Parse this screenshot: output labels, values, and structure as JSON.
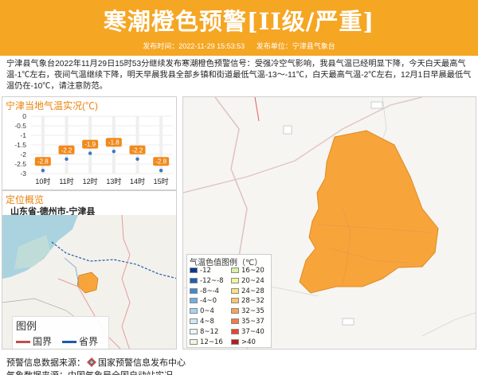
{
  "header": {
    "title": "寒潮橙色预警[II级/严重]",
    "publish_time_label": "发布时间：2022-11-29 15:53:53",
    "publisher_label": "发布单位：宁津县气象台"
  },
  "content": "宁津县气象台2022年11月29日15时53分继续发布寒潮橙色预警信号：受强冷空气影响，我县气温已经明显下降，今天白天最高气温-1℃左右，夜间气温继续下降，明天早晨我县全部乡镇和街道最低气温-13～-11℃，白天最高气温-2℃左右，12月1日早晨最低气温仍在-10℃，请注意防范。",
  "temp_panel": {
    "title": "宁津当地气温实况(℃)"
  },
  "chart_data": {
    "type": "line",
    "categories": [
      "10时",
      "11时",
      "12时",
      "13时",
      "14时",
      "15时"
    ],
    "values": [
      -2.8,
      -2.2,
      -1.9,
      -1.8,
      -2.2,
      -2.8
    ],
    "value_labels": [
      "-2.8",
      "-2.2",
      "-1.9",
      "-1.8",
      "-2.2",
      "-2.8"
    ],
    "y_ticks": [
      "0",
      "-0.5",
      "-1",
      "-1.5",
      "-2",
      "-2.5",
      "-3"
    ],
    "ylim": [
      -3,
      0
    ],
    "grid": true,
    "colors": {
      "marker": "#3a78c3",
      "label_bg": "#f08a1c"
    }
  },
  "location": {
    "title": "定位概览",
    "subtitle": "山东省-德州市-宁津县",
    "legend_title": "图例",
    "legend_items": [
      {
        "label": "国界",
        "color": "#c0504d"
      },
      {
        "label": "省界",
        "color": "#1f5aa6"
      }
    ]
  },
  "color_legend": {
    "title": "气温色值图例（℃）",
    "items": [
      {
        "label": "-12",
        "color": "#0b3a8c"
      },
      {
        "label": "16~20",
        "color": "#d9f0a3"
      },
      {
        "label": "-12~-8",
        "color": "#1f5fb4"
      },
      {
        "label": "20~24",
        "color": "#f3f59a"
      },
      {
        "label": "-8~-4",
        "color": "#3f86d6"
      },
      {
        "label": "24~28",
        "color": "#f9e27d"
      },
      {
        "label": "-4~0",
        "color": "#6eaee7"
      },
      {
        "label": "28~32",
        "color": "#fbc66a"
      },
      {
        "label": "0~4",
        "color": "#a6d3f3"
      },
      {
        "label": "32~35",
        "color": "#f8a35b"
      },
      {
        "label": "4~8",
        "color": "#cde9f6"
      },
      {
        "label": "35~37",
        "color": "#f47b45"
      },
      {
        "label": "8~12",
        "color": "#e8f6f9"
      },
      {
        "label": "37~40",
        "color": "#e8452f"
      },
      {
        "label": "12~16",
        "color": "#eef8e0"
      },
      {
        "label": ">40",
        "color": "#b51d1d"
      }
    ]
  },
  "footer": {
    "source_label": "预警信息数据来源：",
    "source_name": "国家预警信息发布中心",
    "weather_source": "气象数据来源：中国气象局全国自动站实况"
  },
  "colors": {
    "header_bg": "#f5a623",
    "warning_area": "#f7a53b",
    "accent": "#e8820c"
  }
}
